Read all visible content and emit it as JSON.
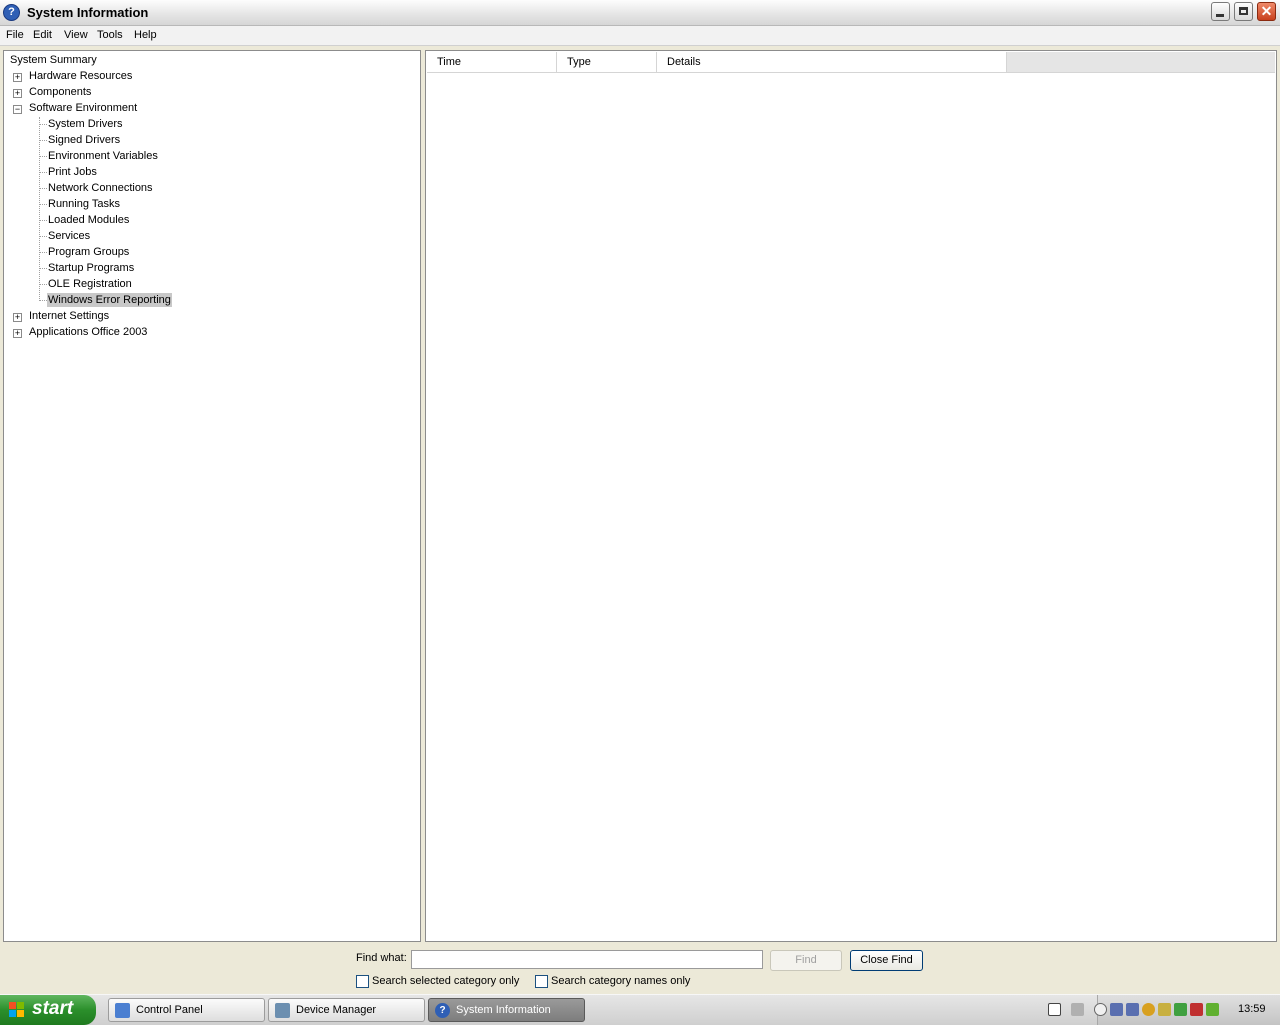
{
  "window": {
    "title": "System Information"
  },
  "menu": [
    "File",
    "Edit",
    "View",
    "Tools",
    "Help"
  ],
  "tree": {
    "root": "System Summary",
    "hardware": "Hardware Resources",
    "components": "Components",
    "software": "Software Environment",
    "software_children": [
      "System Drivers",
      "Signed Drivers",
      "Environment Variables",
      "Print Jobs",
      "Network Connections",
      "Running Tasks",
      "Loaded Modules",
      "Services",
      "Program Groups",
      "Startup Programs",
      "OLE Registration",
      "Windows Error Reporting"
    ],
    "internet": "Internet Settings",
    "office": "Applications Office 2003"
  },
  "list": {
    "columns": [
      "Time",
      "Type",
      "Details"
    ]
  },
  "find": {
    "label": "Find what:",
    "value": "",
    "find_button": "Find",
    "close_button": "Close Find",
    "opt_selected": "Search selected category only",
    "opt_names": "Search category names only"
  },
  "taskbar": {
    "start": "start",
    "tasks": [
      "Control Panel",
      "Device Manager",
      "System Information"
    ],
    "clock": "13:59"
  },
  "colors": {
    "selected_bg": "#c8c8c8",
    "title_gradient": "#e4e4e4",
    "start_green": "#2b8f2b"
  }
}
